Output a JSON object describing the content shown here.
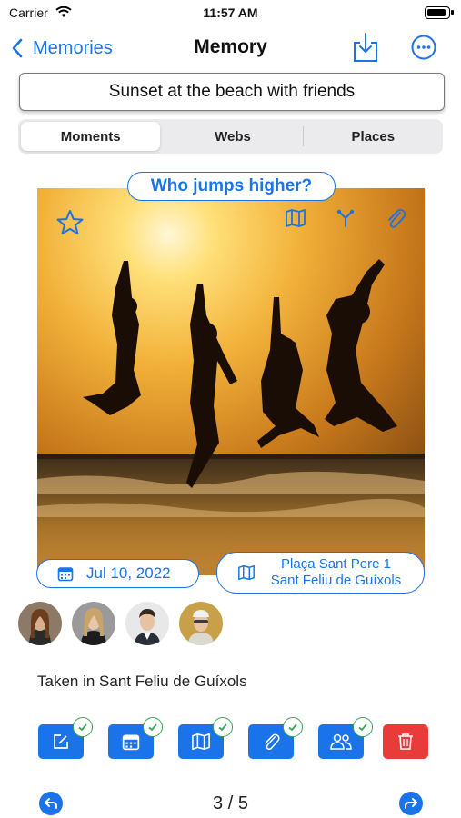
{
  "status": {
    "carrier": "Carrier",
    "time": "11:57 AM"
  },
  "nav": {
    "back_label": "Memories",
    "title": "Memory"
  },
  "memory_title": "Sunset at the beach with friends",
  "segments": [
    {
      "label": "Moments",
      "active": true
    },
    {
      "label": "Webs",
      "active": false
    },
    {
      "label": "Places",
      "active": false
    }
  ],
  "photo": {
    "question": "Who jumps higher?",
    "overlay_icons": [
      "star-icon",
      "map-icon",
      "fork-icon",
      "paperclip-icon"
    ]
  },
  "date_label": "Jul 10, 2022",
  "place": {
    "line1": "Plaça Sant Pere 1",
    "line2": "Sant Feliu de Guíxols"
  },
  "people": [
    "avatar-woman",
    "avatar-woman-2",
    "avatar-man",
    "avatar-man-2"
  ],
  "description": "Taken in Sant Feliu de Guíxols",
  "actions": [
    {
      "icon": "edit-icon",
      "checked": true
    },
    {
      "icon": "calendar-icon",
      "checked": true
    },
    {
      "icon": "map-icon",
      "checked": true
    },
    {
      "icon": "paperclip-icon",
      "checked": true
    },
    {
      "icon": "people-icon",
      "checked": true
    },
    {
      "icon": "trash-icon",
      "checked": false
    }
  ],
  "pager": {
    "text": "3 / 5"
  },
  "colors": {
    "accent": "#1a73e8",
    "danger": "#ea3b3b",
    "check": "#34a853"
  }
}
